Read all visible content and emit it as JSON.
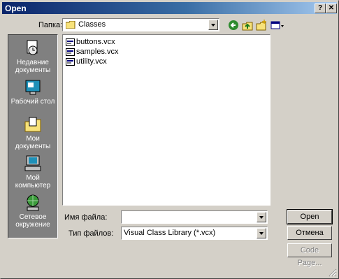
{
  "window": {
    "title": "Open",
    "help_glyph": "?",
    "close_glyph": "✕"
  },
  "lookin": {
    "label": "Папка:",
    "value": "Classes"
  },
  "toolbar": {
    "icons": [
      "back-icon",
      "up-folder-icon",
      "new-folder-icon",
      "view-menu-icon"
    ]
  },
  "places": [
    {
      "label_line1": "Недавние",
      "label_line2": "документы",
      "icon": "recent-documents-icon"
    },
    {
      "label_line1": "Рабочий стол",
      "label_line2": "",
      "icon": "desktop-icon"
    },
    {
      "label_line1": "Мои",
      "label_line2": "документы",
      "icon": "my-documents-icon"
    },
    {
      "label_line1": "Мой",
      "label_line2": "компьютер",
      "icon": "my-computer-icon"
    },
    {
      "label_line1": "Сетевое",
      "label_line2": "окружение",
      "icon": "network-places-icon"
    }
  ],
  "files": [
    {
      "name": "buttons.vcx"
    },
    {
      "name": "samples.vcx"
    },
    {
      "name": "utility.vcx"
    }
  ],
  "filename": {
    "label": "Имя файла:",
    "value": ""
  },
  "filetype": {
    "label": "Тип файлов:",
    "value": "Visual Class Library (*.vcx)"
  },
  "buttons": {
    "open": "Open",
    "cancel": "Отмена",
    "code_page": "Code Page..."
  },
  "colors": {
    "title_start": "#0a246a",
    "title_end": "#a6caf0",
    "face": "#d4d0c8",
    "places_bar": "#808080"
  }
}
